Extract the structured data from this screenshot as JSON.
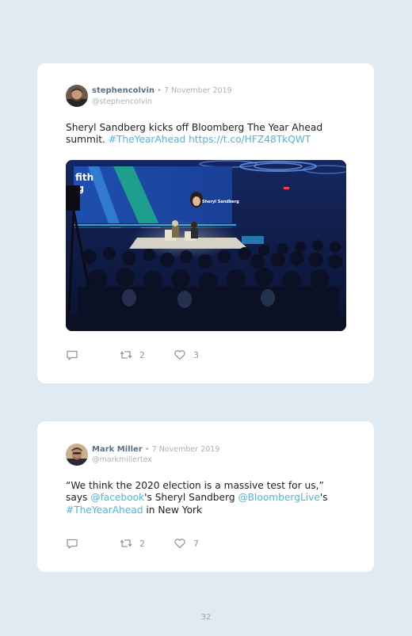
{
  "tweets": [
    {
      "name": "stephencolvin",
      "separator": "•",
      "date": "7 November 2019",
      "handle": "@stephencolvin",
      "text_plain": "Sheryl Sandberg kicks off Bloomberg The Year Ahead summit.",
      "hashtag": "#TheYearAhead",
      "url": "https://t.co/HFZ48TkQWT",
      "retweets": "2",
      "likes": "3",
      "photo_alt": "Sheryl Sandberg on stage at Bloomberg The Year Ahead summit"
    },
    {
      "name": "Mark Miller",
      "separator": "•",
      "date": "7 November 2019",
      "handle": "@markmillertex",
      "text_1": "“We think the 2020 election is a massive test for us,” says",
      "mention_1": "@facebook",
      "text_2": "'s Sheryl Sandberg",
      "mention_2": "@BloombergLive",
      "text_3": "'s",
      "hashtag": "#TheYearAhead",
      "text_4": "in New York",
      "retweets": "2",
      "likes": "7"
    }
  ],
  "page_number": "32",
  "colors": {
    "background": "#dfeaf3",
    "card": "#ffffff",
    "link": "#4cb6e4",
    "muted": "#a5b3bf",
    "name": "#5b7083"
  },
  "icons": {
    "reply": "speech-bubble",
    "retweet": "retweet-arrows",
    "like": "heart-outline"
  }
}
